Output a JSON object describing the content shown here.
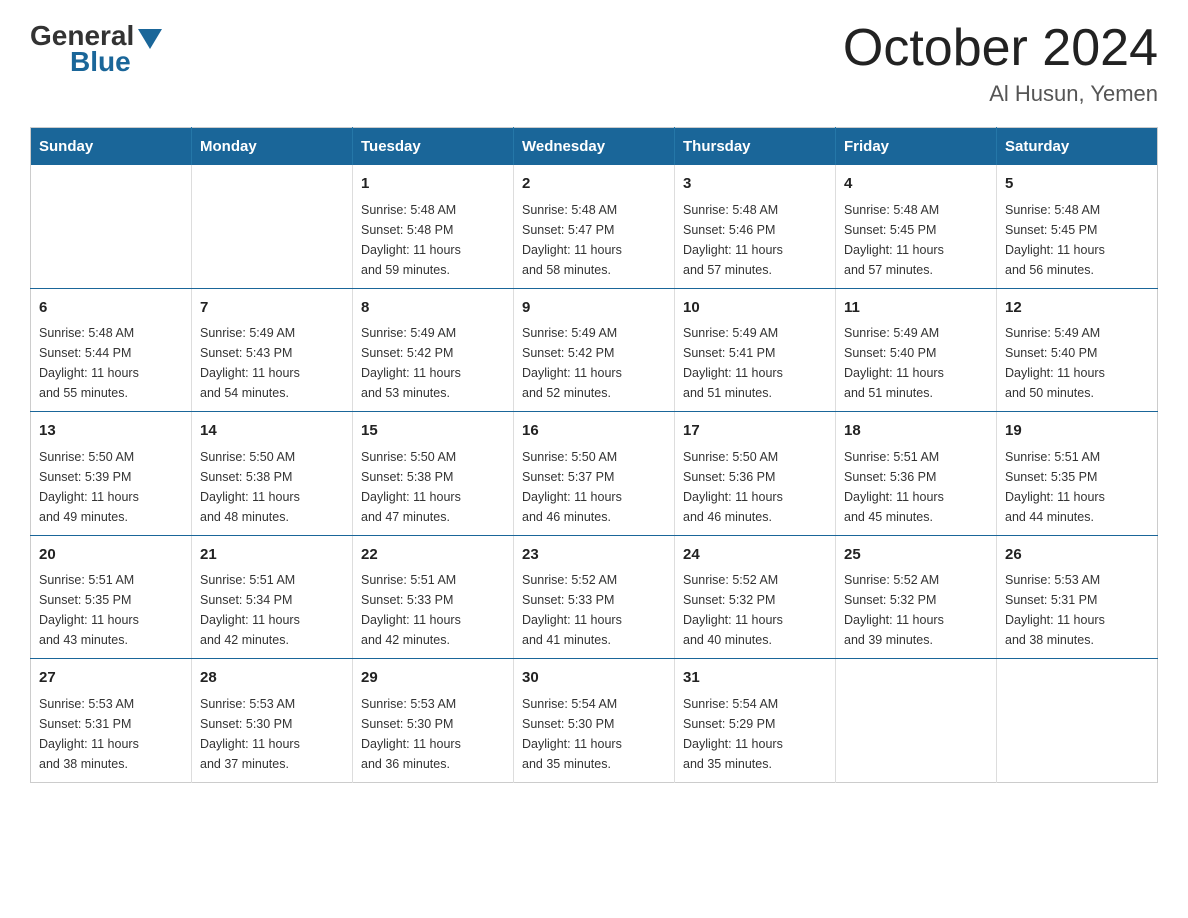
{
  "logo": {
    "general": "General",
    "blue": "Blue"
  },
  "title": "October 2024",
  "subtitle": "Al Husun, Yemen",
  "headers": [
    "Sunday",
    "Monday",
    "Tuesday",
    "Wednesday",
    "Thursday",
    "Friday",
    "Saturday"
  ],
  "weeks": [
    [
      {
        "day": "",
        "info": ""
      },
      {
        "day": "",
        "info": ""
      },
      {
        "day": "1",
        "info": "Sunrise: 5:48 AM\nSunset: 5:48 PM\nDaylight: 11 hours\nand 59 minutes."
      },
      {
        "day": "2",
        "info": "Sunrise: 5:48 AM\nSunset: 5:47 PM\nDaylight: 11 hours\nand 58 minutes."
      },
      {
        "day": "3",
        "info": "Sunrise: 5:48 AM\nSunset: 5:46 PM\nDaylight: 11 hours\nand 57 minutes."
      },
      {
        "day": "4",
        "info": "Sunrise: 5:48 AM\nSunset: 5:45 PM\nDaylight: 11 hours\nand 57 minutes."
      },
      {
        "day": "5",
        "info": "Sunrise: 5:48 AM\nSunset: 5:45 PM\nDaylight: 11 hours\nand 56 minutes."
      }
    ],
    [
      {
        "day": "6",
        "info": "Sunrise: 5:48 AM\nSunset: 5:44 PM\nDaylight: 11 hours\nand 55 minutes."
      },
      {
        "day": "7",
        "info": "Sunrise: 5:49 AM\nSunset: 5:43 PM\nDaylight: 11 hours\nand 54 minutes."
      },
      {
        "day": "8",
        "info": "Sunrise: 5:49 AM\nSunset: 5:42 PM\nDaylight: 11 hours\nand 53 minutes."
      },
      {
        "day": "9",
        "info": "Sunrise: 5:49 AM\nSunset: 5:42 PM\nDaylight: 11 hours\nand 52 minutes."
      },
      {
        "day": "10",
        "info": "Sunrise: 5:49 AM\nSunset: 5:41 PM\nDaylight: 11 hours\nand 51 minutes."
      },
      {
        "day": "11",
        "info": "Sunrise: 5:49 AM\nSunset: 5:40 PM\nDaylight: 11 hours\nand 51 minutes."
      },
      {
        "day": "12",
        "info": "Sunrise: 5:49 AM\nSunset: 5:40 PM\nDaylight: 11 hours\nand 50 minutes."
      }
    ],
    [
      {
        "day": "13",
        "info": "Sunrise: 5:50 AM\nSunset: 5:39 PM\nDaylight: 11 hours\nand 49 minutes."
      },
      {
        "day": "14",
        "info": "Sunrise: 5:50 AM\nSunset: 5:38 PM\nDaylight: 11 hours\nand 48 minutes."
      },
      {
        "day": "15",
        "info": "Sunrise: 5:50 AM\nSunset: 5:38 PM\nDaylight: 11 hours\nand 47 minutes."
      },
      {
        "day": "16",
        "info": "Sunrise: 5:50 AM\nSunset: 5:37 PM\nDaylight: 11 hours\nand 46 minutes."
      },
      {
        "day": "17",
        "info": "Sunrise: 5:50 AM\nSunset: 5:36 PM\nDaylight: 11 hours\nand 46 minutes."
      },
      {
        "day": "18",
        "info": "Sunrise: 5:51 AM\nSunset: 5:36 PM\nDaylight: 11 hours\nand 45 minutes."
      },
      {
        "day": "19",
        "info": "Sunrise: 5:51 AM\nSunset: 5:35 PM\nDaylight: 11 hours\nand 44 minutes."
      }
    ],
    [
      {
        "day": "20",
        "info": "Sunrise: 5:51 AM\nSunset: 5:35 PM\nDaylight: 11 hours\nand 43 minutes."
      },
      {
        "day": "21",
        "info": "Sunrise: 5:51 AM\nSunset: 5:34 PM\nDaylight: 11 hours\nand 42 minutes."
      },
      {
        "day": "22",
        "info": "Sunrise: 5:51 AM\nSunset: 5:33 PM\nDaylight: 11 hours\nand 42 minutes."
      },
      {
        "day": "23",
        "info": "Sunrise: 5:52 AM\nSunset: 5:33 PM\nDaylight: 11 hours\nand 41 minutes."
      },
      {
        "day": "24",
        "info": "Sunrise: 5:52 AM\nSunset: 5:32 PM\nDaylight: 11 hours\nand 40 minutes."
      },
      {
        "day": "25",
        "info": "Sunrise: 5:52 AM\nSunset: 5:32 PM\nDaylight: 11 hours\nand 39 minutes."
      },
      {
        "day": "26",
        "info": "Sunrise: 5:53 AM\nSunset: 5:31 PM\nDaylight: 11 hours\nand 38 minutes."
      }
    ],
    [
      {
        "day": "27",
        "info": "Sunrise: 5:53 AM\nSunset: 5:31 PM\nDaylight: 11 hours\nand 38 minutes."
      },
      {
        "day": "28",
        "info": "Sunrise: 5:53 AM\nSunset: 5:30 PM\nDaylight: 11 hours\nand 37 minutes."
      },
      {
        "day": "29",
        "info": "Sunrise: 5:53 AM\nSunset: 5:30 PM\nDaylight: 11 hours\nand 36 minutes."
      },
      {
        "day": "30",
        "info": "Sunrise: 5:54 AM\nSunset: 5:30 PM\nDaylight: 11 hours\nand 35 minutes."
      },
      {
        "day": "31",
        "info": "Sunrise: 5:54 AM\nSunset: 5:29 PM\nDaylight: 11 hours\nand 35 minutes."
      },
      {
        "day": "",
        "info": ""
      },
      {
        "day": "",
        "info": ""
      }
    ]
  ]
}
